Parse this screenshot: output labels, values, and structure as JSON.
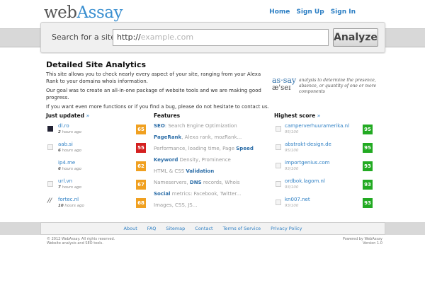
{
  "brand": {
    "logo_part1": "web",
    "logo_part2": "Assay"
  },
  "topnav": {
    "items": [
      "Home",
      "Sign Up",
      "Sign In"
    ]
  },
  "search": {
    "label": "Search for a site:",
    "prefix": "http://",
    "placeholder": "example.com",
    "button": "Analyze"
  },
  "intro": {
    "title": "Detailed Site Analytics",
    "p1": "This site allows you to check nearly every aspect of your site, ranging from your Alexa Rank to your domains whois information.",
    "p2": "Our goal was to create an all-in-one package of website tools and we are making good progress.",
    "p3": "If you want even more functions or if you find a bug, please do not hesitate to contact us."
  },
  "definition": {
    "word": "as·say",
    "pron": "æ'seɪ",
    "text": "analysis to determine the presence, absence, or quantity of one or more components"
  },
  "just_updated": {
    "title": "Just updated",
    "more": "»",
    "items": [
      {
        "site": "dl.ro",
        "num": "2",
        "ago": "hours ago",
        "score": "65",
        "color": "#f0a020"
      },
      {
        "site": "aab.si",
        "num": "6",
        "ago": "hours ago",
        "score": "55",
        "color": "#d42020"
      },
      {
        "site": "ip4.me",
        "num": "6",
        "ago": "hours ago",
        "score": "62",
        "color": "#f0a020"
      },
      {
        "site": "url.vn",
        "num": "7",
        "ago": "hours ago",
        "score": "67",
        "color": "#f0a020"
      },
      {
        "site": "fortec.nl",
        "num": "10",
        "ago": "hours ago",
        "score": "68",
        "color": "#f0a020"
      }
    ]
  },
  "features": {
    "title": "Features",
    "items": [
      {
        "key": "SEO",
        "rest": ": Search Engine Optimization",
        "pre": ""
      },
      {
        "key": "PageRank",
        "rest": ", Alexa rank, mozRank...",
        "pre": ""
      },
      {
        "key": "Speed",
        "rest": "",
        "pre": "Performance, loading time, Page "
      },
      {
        "key": "Keyword",
        "rest": " Density, Prominence",
        "pre": ""
      },
      {
        "key": "Validation",
        "rest": "",
        "pre": "HTML & CSS "
      },
      {
        "key": "DNS",
        "rest": " records, Whois",
        "pre": "Nameservers, "
      },
      {
        "key": "Social",
        "rest": " metrics: Facebook, Twitter...",
        "pre": ""
      },
      {
        "key": "",
        "rest": "",
        "pre": "Images, CSS, JS..."
      }
    ]
  },
  "highest": {
    "title": "Highest score",
    "more": "»",
    "items": [
      {
        "site": "camperverhuuramerika.nl",
        "count": "95/100",
        "score": "95",
        "color": "#22aa22"
      },
      {
        "site": "abstrakt-design.de",
        "count": "95/100",
        "score": "95",
        "color": "#22aa22"
      },
      {
        "site": "importgenius.com",
        "count": "93/100",
        "score": "93",
        "color": "#22aa22"
      },
      {
        "site": "ordbok.lagom.nl",
        "count": "93/100",
        "score": "93",
        "color": "#22aa22"
      },
      {
        "site": "kn007.net",
        "count": "93/100",
        "score": "93",
        "color": "#22aa22"
      }
    ]
  },
  "footer": {
    "links": [
      "About",
      "FAQ",
      "Sitemap",
      "Contact",
      "Terms of Service",
      "Privacy Policy"
    ],
    "copy_left_1": "© 2012 WebAssay. All rights reserved.",
    "copy_left_2": "Website analysis and SEO tools.",
    "copy_right_1": "Powered by WebAssay",
    "copy_right_2": "Version 1.0"
  }
}
